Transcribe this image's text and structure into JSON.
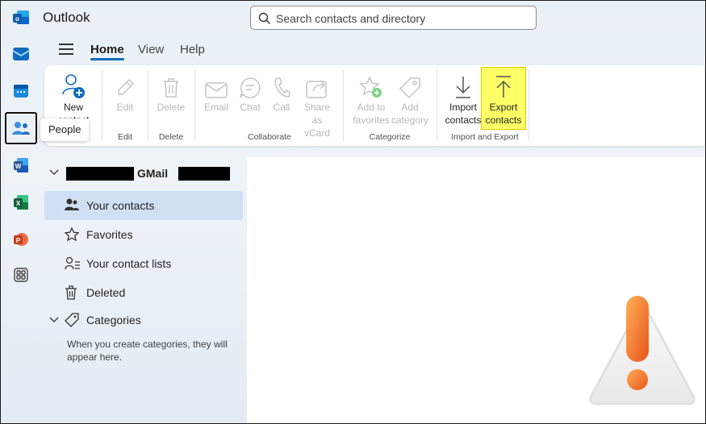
{
  "app": {
    "title": "Outlook"
  },
  "search": {
    "placeholder": "Search contacts and directory"
  },
  "rail": {
    "items": [
      {
        "name": "outlook-mail",
        "icon": "mail-icon"
      },
      {
        "name": "calendar",
        "icon": "calendar-icon"
      },
      {
        "name": "people",
        "icon": "people-icon",
        "active": true
      },
      {
        "name": "word",
        "icon": "word-icon"
      },
      {
        "name": "excel",
        "icon": "excel-icon"
      },
      {
        "name": "powerpoint",
        "icon": "powerpoint-icon"
      },
      {
        "name": "more-apps",
        "icon": "apps-icon"
      }
    ],
    "tooltip": "People"
  },
  "tabs": [
    {
      "label": "Home",
      "active": true
    },
    {
      "label": "View"
    },
    {
      "label": "Help"
    }
  ],
  "ribbon": {
    "new_contact": "New",
    "new_contact_line2": "contact",
    "edit": "Edit",
    "delete": "Delete",
    "email": "Email",
    "chat": "Chat",
    "call": "Call",
    "share": "Share as",
    "share_line2": "vCard",
    "add_fav": "Add to",
    "add_fav_line2": "favorites",
    "add_cat": "Add",
    "add_cat_line2": "category",
    "import": "Import",
    "import_line2": "contacts",
    "export": "Export",
    "export_line2": "contacts",
    "groups": {
      "edit": "Edit",
      "delete": "Delete",
      "collaborate": "Collaborate",
      "categorize": "Categorize",
      "import_export": "Import and Export"
    }
  },
  "nav": {
    "account_label": "GMail",
    "items": [
      {
        "label": "Your contacts",
        "selected": true
      },
      {
        "label": "Favorites"
      },
      {
        "label": "Your contact lists"
      },
      {
        "label": "Deleted"
      },
      {
        "label": "Categories"
      }
    ],
    "categories_hint": "When you create categories, they will appear here."
  },
  "colors": {
    "accent": "#0f6cbd",
    "highlight": "#ffff66",
    "selected": "#cfe0f5"
  }
}
